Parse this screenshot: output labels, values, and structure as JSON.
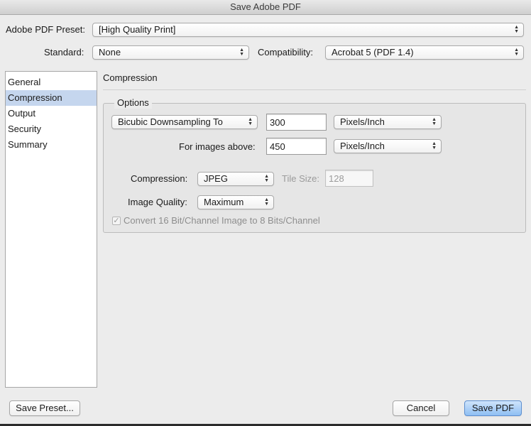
{
  "window": {
    "title": "Save Adobe PDF"
  },
  "top": {
    "preset_label": "Adobe PDF Preset:",
    "preset_value": "[High Quality Print]",
    "standard_label": "Standard:",
    "standard_value": "None",
    "compatibility_label": "Compatibility:",
    "compatibility_value": "Acrobat 5 (PDF 1.4)"
  },
  "sidebar": {
    "items": [
      {
        "label": "General"
      },
      {
        "label": "Compression"
      },
      {
        "label": "Output"
      },
      {
        "label": "Security"
      },
      {
        "label": "Summary"
      }
    ],
    "selected_index": 1
  },
  "panel": {
    "title": "Compression",
    "options_label": "Options",
    "downsampling_value": "Bicubic Downsampling To",
    "resolution_value": "300",
    "resolution_unit": "Pixels/Inch",
    "images_above_label": "For images above:",
    "images_above_value": "450",
    "images_above_unit": "Pixels/Inch",
    "compression_label": "Compression:",
    "compression_value": "JPEG",
    "tile_size_label": "Tile Size:",
    "tile_size_value": "128",
    "image_quality_label": "Image Quality:",
    "image_quality_value": "Maximum",
    "convert_label": "Convert 16 Bit/Channel Image to 8 Bits/Channel",
    "convert_checked": true
  },
  "buttons": {
    "save_preset": "Save Preset...",
    "cancel": "Cancel",
    "save_pdf": "Save PDF"
  },
  "icons": {
    "popup_arrows": "up-down-arrows-icon",
    "checkmark": "checkmark-icon"
  },
  "colors": {
    "selection": "#c5d6ee",
    "default_button": "#8fbff3",
    "window_bg": "#ececec"
  }
}
